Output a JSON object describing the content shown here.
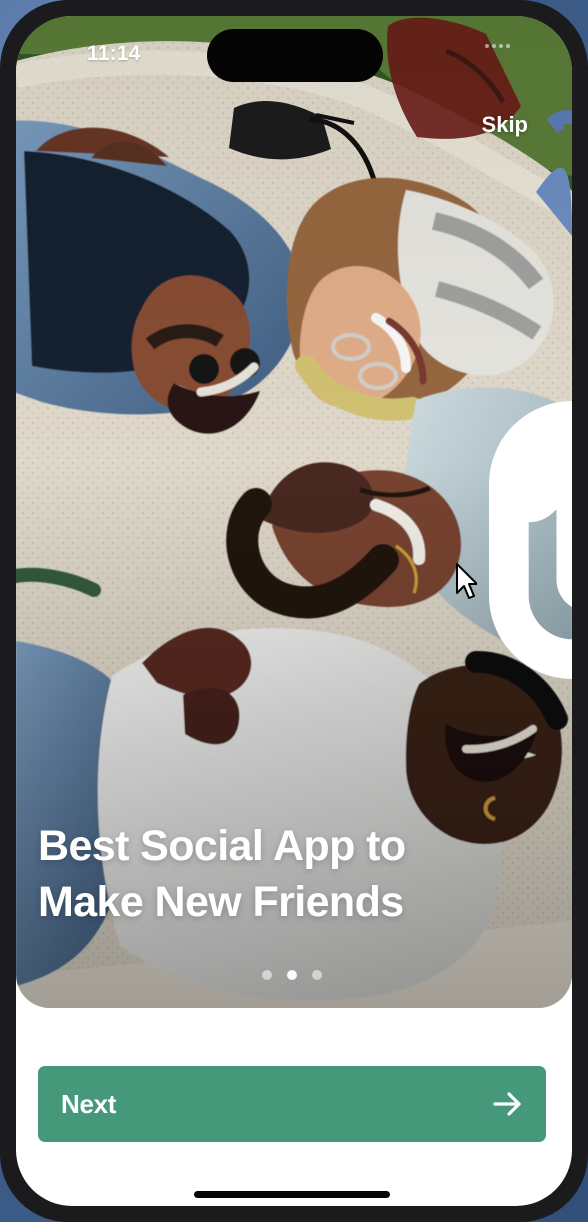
{
  "status_bar": {
    "time": "11:14",
    "icons": [
      "signal-dots-icon",
      "wifi-icon",
      "battery-icon"
    ]
  },
  "onboarding": {
    "skip_label": "Skip",
    "headline": "Best Social App to\nMake New Friends",
    "page_count": 3,
    "current_page": 2
  },
  "actions": {
    "next_label": "Next",
    "next_icon": "arrow-right-icon"
  },
  "colors": {
    "accent": "#45997a",
    "text_on_image": "#ffffff",
    "background": "#ffffff",
    "device_frame": "#1b1b1d"
  },
  "hero_image": {
    "description_icon": "people-lying-on-blanket-image"
  }
}
